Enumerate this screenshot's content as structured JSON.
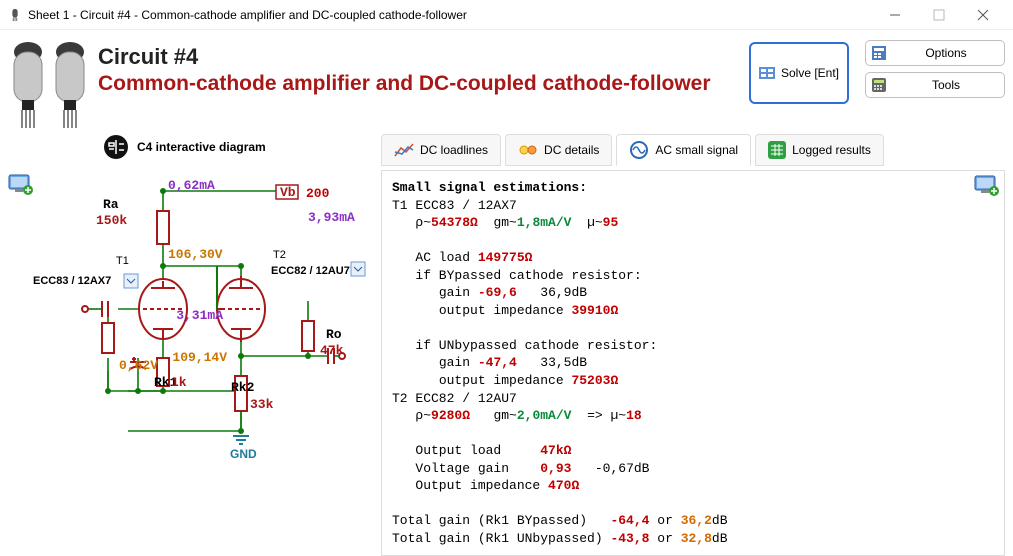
{
  "window": {
    "title": "Sheet 1 - Circuit #4 - Common-cathode amplifier and DC-coupled cathode-follower"
  },
  "header": {
    "title1": "Circuit #4",
    "title2": "Common-cathode amplifier and DC-coupled cathode-follower",
    "solve_label": "Solve [Ent]",
    "options_label": "Options",
    "tools_label": "Tools"
  },
  "diagram": {
    "title": "C4 interactive diagram",
    "labels": {
      "Ra": "Ra",
      "Ra_val": "150k",
      "T1": "T1",
      "T1_tube": "ECC83 / 12AX7",
      "T2": "T2",
      "T2_tube": "ECC82 / 12AU7",
      "Rk1": "Rk1",
      "Rk1_val": "1k",
      "Rk2": "Rk2",
      "Rk2_val": "33k",
      "Ro": "Ro",
      "Ro_val": "47k",
      "Vb": "Vb",
      "Vb_val": "200",
      "GND": "GND",
      "i_Ra": "0,62mA",
      "i_total": "3,93mA",
      "v_plate": "106,30V",
      "i_T2": "3,31mA",
      "v_cath2": "109,14V",
      "v_cath1": "0,62V"
    }
  },
  "tabs": {
    "dc_loadlines": "DC loadlines",
    "dc_details": "DC details",
    "ac_small": "AC small signal",
    "logged": "Logged results"
  },
  "out": {
    "hdr": "Small signal estimations:",
    "t1_line": "T1 ECC83 / 12AX7",
    "t1_rho": "54378Ω",
    "t1_gm": "1,8mA/V",
    "t1_mu": "95",
    "ac_load_lbl": "AC load",
    "ac_load": "149775Ω",
    "byp_lbl": "if BYpassed cathode resistor:",
    "byp_gain": "-69,6",
    "byp_db": "36,9dB",
    "byp_zout": "39910Ω",
    "unbyp_lbl": "if UNbypassed cathode resistor:",
    "unbyp_gain": "-47,4",
    "unbyp_db": "33,5dB",
    "unbyp_zout": "75203Ω",
    "t2_line": "T2 ECC82 / 12AU7",
    "t2_rho": "9280Ω",
    "t2_gm": "2,0mA/V",
    "t2_mu": "18",
    "outload_lbl": "Output load",
    "outload": "47kΩ",
    "vg_lbl": "Voltage gain",
    "vg": "0,93",
    "vg_db": "-0,67dB",
    "zout_lbl": "Output impedance",
    "zout": "470Ω",
    "tot_byp_lbl": "Total gain (Rk1 BYpassed)",
    "tot_byp": "-64,4",
    "tot_byp_db": "36,2",
    "tot_unbyp_lbl": "Total gain (Rk1 UNbypassed)",
    "tot_unbyp": "-43,8",
    "tot_unbyp_db": "32,8",
    "db_suffix": "dB",
    "or": "or",
    "gain_lbl": "gain",
    "zout_word": "output impedance",
    "rho": "ρ~",
    "gm": "gm~",
    "mu": "µ~",
    "arrow": "=> µ~"
  }
}
